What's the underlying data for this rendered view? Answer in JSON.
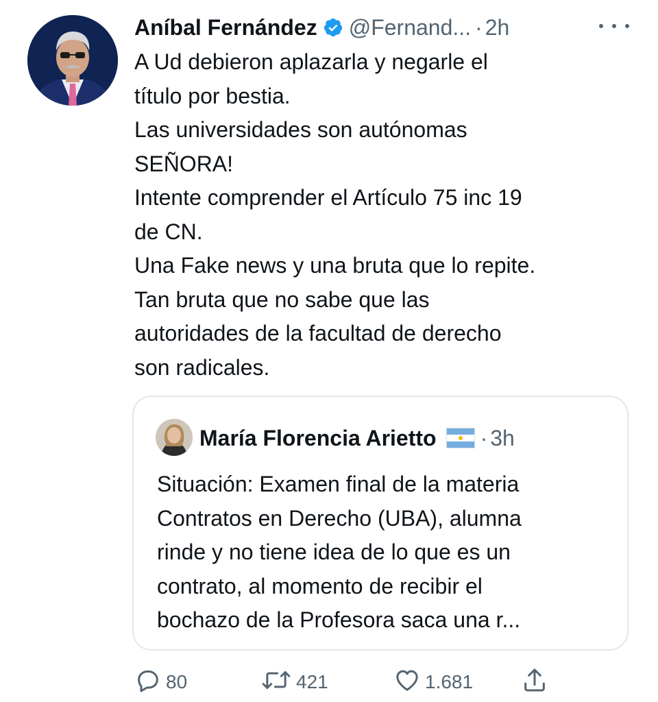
{
  "tweet": {
    "author_name": "Aníbal Fernández",
    "handle": "@Fernand...",
    "separator": "·",
    "time": "2h",
    "verified_icon": "verified-badge-icon",
    "more_icon": "more-icon",
    "text_lines": [
      "A Ud debieron aplazarla y negarle el",
      "título por bestia.",
      "Las universidades son autónomas",
      "SEÑORA!",
      "Intente comprender el Artículo 75 inc 19",
      "de CN.",
      "Una Fake news y una bruta que lo repite.",
      "Tan bruta que no sabe que las",
      "autoridades de la facultad de derecho",
      "son radicales."
    ]
  },
  "quoted": {
    "author_name": "María Florencia Arietto",
    "flag_icon": "argentina-flag-icon",
    "separator": "·",
    "time": "3h",
    "text_lines": [
      "Situación: Examen final de la materia",
      "Contratos en Derecho (UBA), alumna",
      "rinde y no tiene idea de lo que es un",
      "contrato, al momento de recibir el",
      "bochazo de la Profesora saca una r..."
    ]
  },
  "actions": {
    "reply": {
      "icon": "reply-icon",
      "count": "80"
    },
    "retweet": {
      "icon": "retweet-icon",
      "count": "421"
    },
    "like": {
      "icon": "heart-icon",
      "count": "1.681"
    },
    "share": {
      "icon": "share-icon"
    }
  },
  "colors": {
    "text": "#0f1419",
    "secondary": "#536471",
    "verified_blue": "#1d9bf0",
    "border": "#e1e8ed"
  }
}
